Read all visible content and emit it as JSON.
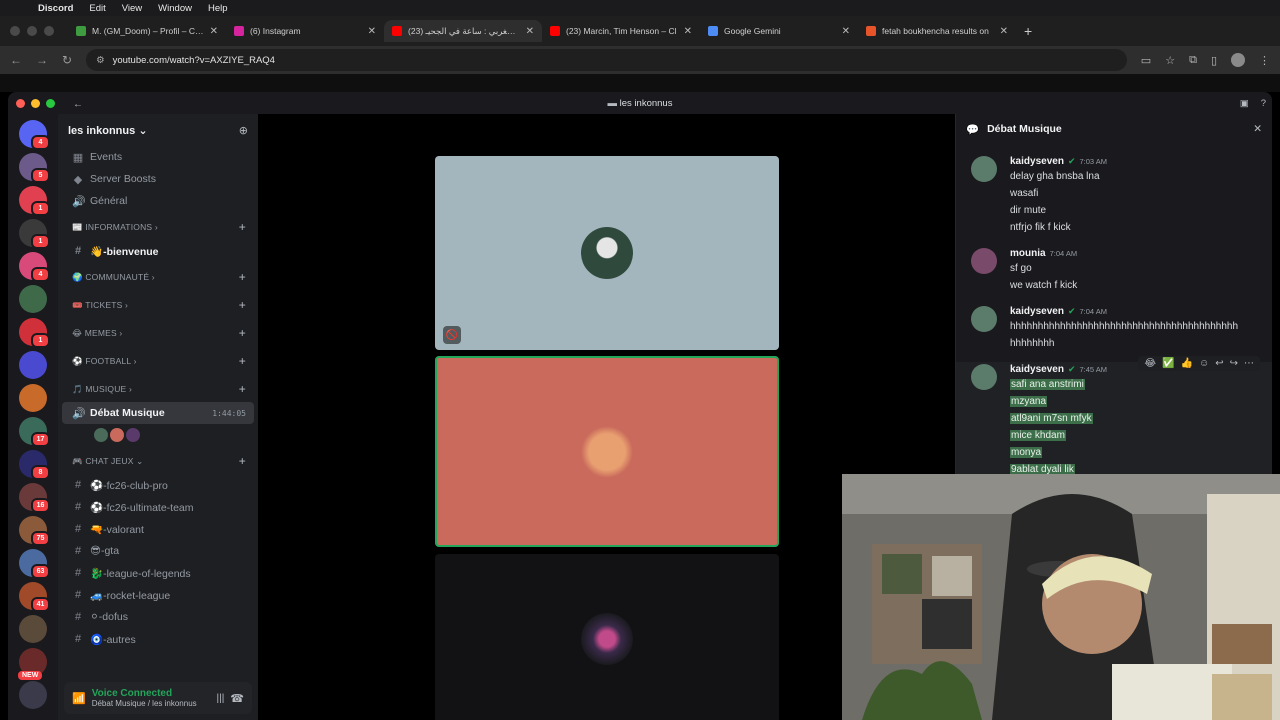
{
  "menubar": {
    "app": "Discord",
    "items": [
      "Edit",
      "View",
      "Window",
      "Help"
    ]
  },
  "browser": {
    "tabs": [
      {
        "label": "M. (GM_Doom) – Profil – Che",
        "color": "#3f9b3f"
      },
      {
        "label": "(6) Instagram",
        "color": "#d6249f"
      },
      {
        "label": "فيلم مغربي : ساعة في الجحيـ (23)",
        "color": "#ff0000"
      },
      {
        "label": "(23) Marcin, Tim Henson – Cl",
        "color": "#ff0000"
      },
      {
        "label": "Google Gemini",
        "color": "#4e8cf5"
      },
      {
        "label": "fetah boukhencha results on",
        "color": "#e8542a"
      }
    ],
    "url": "youtube.com/watch?v=AXZIYE_RAQ4"
  },
  "discord": {
    "window_title": "les inkonnus",
    "server_name": "les inkonnus",
    "guild_badges": [
      "4",
      "5",
      "1",
      "1",
      "4",
      "",
      "1",
      "",
      "",
      "17",
      "8",
      "16",
      "75",
      "63",
      "41",
      "",
      "",
      ""
    ],
    "new_label": "NEW",
    "channels": [
      {
        "type": "item",
        "icon": "calendar-icon",
        "glyph": "▦",
        "label": "Events"
      },
      {
        "type": "item",
        "icon": "boost-icon",
        "glyph": "◆",
        "label": "Server Boosts"
      },
      {
        "type": "item",
        "icon": "speaker-icon",
        "glyph": "🔊",
        "label": "Général"
      },
      {
        "type": "cat",
        "label": "📰 INFORMATIONS ›"
      },
      {
        "type": "item",
        "icon": "hash-icon",
        "glyph": "#",
        "label": "👋-bienvenue",
        "unread": true
      },
      {
        "type": "cat",
        "label": "🌍 COMMUNAUTÉ ›"
      },
      {
        "type": "cat",
        "label": "🎟️ TICKETS ›"
      },
      {
        "type": "cat",
        "label": "😂 MEMES ›"
      },
      {
        "type": "cat",
        "label": "⚽ FOOTBALL ›"
      },
      {
        "type": "cat",
        "label": "🎵 MUSIQUE ›"
      },
      {
        "type": "voice",
        "icon": "speaker-icon",
        "glyph": "🔊",
        "label": "Débat Musique",
        "time": "1:44:05"
      },
      {
        "type": "voiceusers"
      },
      {
        "type": "cat",
        "label": "🎮 CHAT JEUX ⌄"
      },
      {
        "type": "item",
        "icon": "hash-icon",
        "glyph": "#",
        "label": "⚽-fc26-club-pro"
      },
      {
        "type": "item",
        "icon": "hash-icon",
        "glyph": "#",
        "label": "⚽-fc26-ultimate-team"
      },
      {
        "type": "item",
        "icon": "hash-icon",
        "glyph": "#",
        "label": "🔫-valorant"
      },
      {
        "type": "item",
        "icon": "hash-icon",
        "glyph": "#",
        "label": "😎-gta"
      },
      {
        "type": "item",
        "icon": "hash-icon",
        "glyph": "#",
        "label": "🐉-league-of-legends"
      },
      {
        "type": "item",
        "icon": "hash-icon",
        "glyph": "#",
        "label": "🚙-rocket-league"
      },
      {
        "type": "item",
        "icon": "hash-icon",
        "glyph": "#",
        "label": "⚪-dofus"
      },
      {
        "type": "item",
        "icon": "hash-icon",
        "glyph": "#",
        "label": "🧿-autres"
      }
    ],
    "voice_panel": {
      "title": "Voice Connected",
      "subtitle": "Débat Musique / les inkonnus"
    },
    "chat": {
      "title": "Débat Musique",
      "messages": [
        {
          "author": "kaidyseven",
          "verified": true,
          "time": "7:03 AM",
          "avatar": "#5b7b6b",
          "lines": [
            "delay gha bnsba lna",
            "wasafi",
            "dir mute",
            "ntfrjo fik f kick"
          ]
        },
        {
          "author": "mounia",
          "verified": false,
          "time": "7:04 AM",
          "avatar": "#7a4a6a",
          "lines": [
            "sf go",
            "we watch f kick"
          ]
        },
        {
          "author": "kaidyseven",
          "verified": true,
          "time": "7:04 AM",
          "avatar": "#5b7b6b",
          "lines": [
            "hhhhhhhhhhhhhhhhhhhhhhhhhhhhhhhhhhhhhhhhh",
            "hhhhhhhh"
          ]
        },
        {
          "author": "kaidyseven",
          "verified": true,
          "time": "7:45 AM",
          "avatar": "#5b7b6b",
          "selected": true,
          "lines": [
            "safi ana anstrimi",
            "mzyana",
            "atl9ani m7sn mfyk",
            "mice khdam",
            "monya",
            "9ablat dyali lik"
          ]
        }
      ]
    }
  }
}
